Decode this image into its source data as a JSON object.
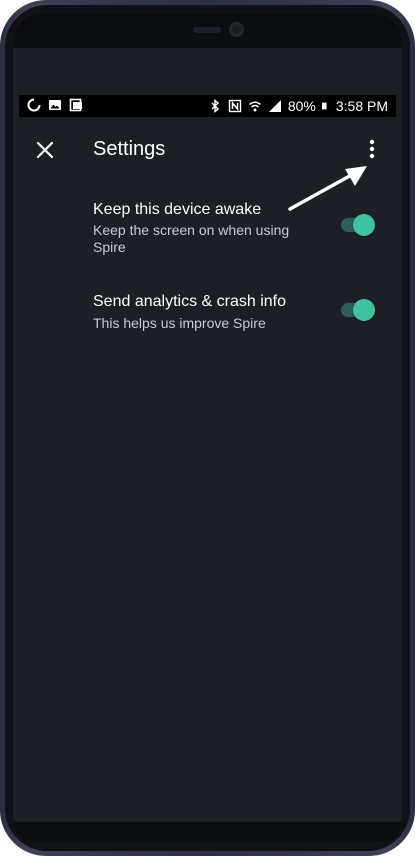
{
  "status_bar": {
    "battery_percent": "80%",
    "time": "3:58 PM",
    "left_icons": [
      "sync-icon",
      "image-icon",
      "screenshot-icon"
    ],
    "right_icons": [
      "bluetooth-icon",
      "nfc-icon",
      "wifi-icon",
      "signal-icon",
      "battery-icon"
    ]
  },
  "header": {
    "title": "Settings",
    "close_icon": "close-icon",
    "menu_icon": "more-vert-icon"
  },
  "settings": [
    {
      "title": "Keep this device awake",
      "subtitle": "Keep the screen on when using Spire",
      "enabled": true
    },
    {
      "title": "Send analytics & crash info",
      "subtitle": "This helps us improve Spire",
      "enabled": true
    }
  ],
  "colors": {
    "background": "#1c1f24",
    "toggle_on": "#3ec3a1",
    "toggle_track": "#2e5f57",
    "text_primary": "#ffffff",
    "text_secondary": "#c9ccd1"
  }
}
